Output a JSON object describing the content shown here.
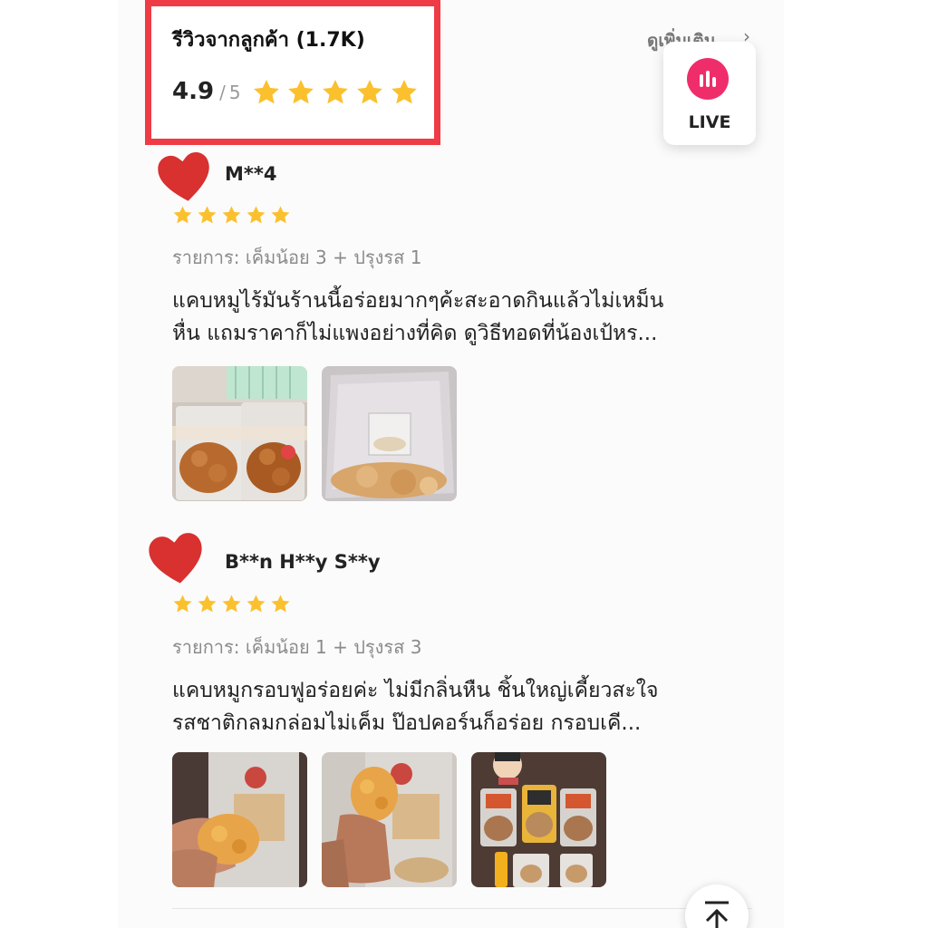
{
  "header": {
    "title": "รีวิวจากลูกค้า (1.7K)",
    "rating": "4.9",
    "rating_slash": "/",
    "rating_max": "5",
    "star_color": "#fbc02d",
    "see_more": "ดูเพิ่มเติม",
    "see_more_chevron": "›"
  },
  "live": {
    "label": "LIVE",
    "icon": "live-bars-icon",
    "color": "#ef2d6b"
  },
  "reviews": [
    {
      "name": "M**4",
      "stars": 5,
      "variant": "รายการ: เค็มน้อย 3 + ปรุงรส 1",
      "text_line1": "แคบหมูไร้มันร้านนี้อร่อยมากๆค้ะสะอาดกินแล้วไม่เหม็น",
      "text_line2": "หื่น แถมราคาก็ไม่แพงอย่างที่คิด ดูวิธีทอดที่น้องเป้หร..."
    },
    {
      "name": "B**n H**y S**y",
      "stars": 5,
      "variant": "รายการ: เค็มน้อย 1 + ปรุงรส 3",
      "text_line1": "แคบหมูกรอบฟูอร่อยค่ะ ไม่มีกลิ่นหืน  ชิ้นใหญ่เคี้ยวสะใจ",
      "text_line2": "รสชาติกลมกล่อมไม่เค็ม  ป๊อปคอร์นก็อร่อย กรอบเคี..."
    }
  ],
  "scroll_top_icon": "scroll-to-top-icon",
  "heart_color": "#d93030"
}
